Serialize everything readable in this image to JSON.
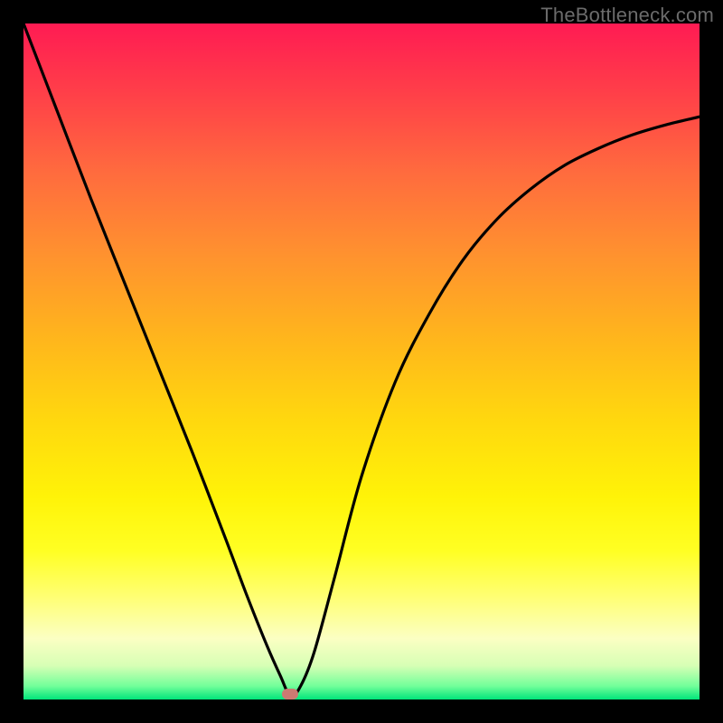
{
  "watermark": "TheBottleneck.com",
  "marker": {
    "x_frac": 0.395,
    "y_frac": 0.992
  },
  "colors": {
    "curve_stroke": "#000000",
    "marker_fill": "#cc7a72",
    "frame_bg_top": "#ff1b53",
    "frame_bg_bottom": "#00e57a",
    "page_bg": "#000000"
  },
  "chart_data": {
    "type": "line",
    "title": "",
    "xlabel": "",
    "ylabel": "",
    "xlim": [
      0,
      1
    ],
    "ylim": [
      0,
      1
    ],
    "series": [
      {
        "name": "curve",
        "x": [
          0.0,
          0.05,
          0.1,
          0.15,
          0.2,
          0.25,
          0.3,
          0.33,
          0.36,
          0.38,
          0.395,
          0.41,
          0.43,
          0.46,
          0.5,
          0.55,
          0.6,
          0.65,
          0.7,
          0.75,
          0.8,
          0.85,
          0.9,
          0.95,
          1.0
        ],
        "y": [
          1.0,
          0.87,
          0.74,
          0.615,
          0.49,
          0.365,
          0.235,
          0.155,
          0.08,
          0.035,
          0.005,
          0.02,
          0.07,
          0.18,
          0.33,
          0.47,
          0.57,
          0.65,
          0.71,
          0.755,
          0.79,
          0.815,
          0.835,
          0.85,
          0.862
        ]
      }
    ],
    "annotations": [
      {
        "type": "marker",
        "x": 0.395,
        "y": 0.005
      }
    ]
  }
}
